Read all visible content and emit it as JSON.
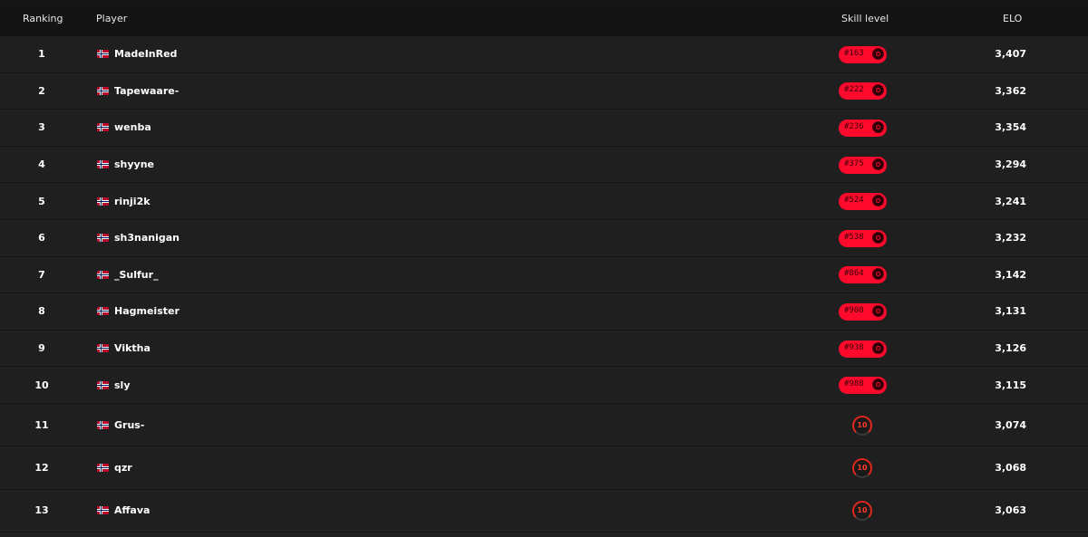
{
  "header": {
    "ranking": "Ranking",
    "player": "Player",
    "skill_level": "Skill level",
    "elo": "ELO"
  },
  "colors": {
    "background": "#1f1f1f",
    "header_bg": "#141414",
    "challenger_badge": "#ff0a2c",
    "level_ring": "#e3261e"
  },
  "rows": [
    {
      "rank": "1",
      "name": "MadeInRed",
      "flag": "norway-flag-icon",
      "badge_type": "challenger",
      "badge": "#163",
      "elo": "3,407"
    },
    {
      "rank": "2",
      "name": "Tapewaare-",
      "flag": "norway-flag-icon",
      "badge_type": "challenger",
      "badge": "#222",
      "elo": "3,362"
    },
    {
      "rank": "3",
      "name": "wenba",
      "flag": "norway-flag-icon",
      "badge_type": "challenger",
      "badge": "#236",
      "elo": "3,354"
    },
    {
      "rank": "4",
      "name": "shyyne",
      "flag": "norway-flag-icon",
      "badge_type": "challenger",
      "badge": "#375",
      "elo": "3,294"
    },
    {
      "rank": "5",
      "name": "rinji2k",
      "flag": "norway-flag-icon",
      "badge_type": "challenger",
      "badge": "#524",
      "elo": "3,241"
    },
    {
      "rank": "6",
      "name": "sh3nanigan",
      "flag": "norway-flag-icon",
      "badge_type": "challenger",
      "badge": "#538",
      "elo": "3,232"
    },
    {
      "rank": "7",
      "name": "_Sulfur_",
      "flag": "norway-flag-icon",
      "badge_type": "challenger",
      "badge": "#864",
      "elo": "3,142"
    },
    {
      "rank": "8",
      "name": "Hagmeister",
      "flag": "norway-flag-icon",
      "badge_type": "challenger",
      "badge": "#908",
      "elo": "3,131"
    },
    {
      "rank": "9",
      "name": "Viktha",
      "flag": "norway-flag-icon",
      "badge_type": "challenger",
      "badge": "#938",
      "elo": "3,126"
    },
    {
      "rank": "10",
      "name": "sly",
      "flag": "norway-flag-icon",
      "badge_type": "challenger",
      "badge": "#988",
      "elo": "3,115"
    },
    {
      "rank": "11",
      "name": "Grus-",
      "flag": "norway-flag-icon",
      "badge_type": "level",
      "badge": "10",
      "elo": "3,074"
    },
    {
      "rank": "12",
      "name": "qzr",
      "flag": "norway-flag-icon",
      "badge_type": "level",
      "badge": "10",
      "elo": "3,068"
    },
    {
      "rank": "13",
      "name": "Affava",
      "flag": "norway-flag-icon",
      "badge_type": "level",
      "badge": "10",
      "elo": "3,063"
    }
  ]
}
